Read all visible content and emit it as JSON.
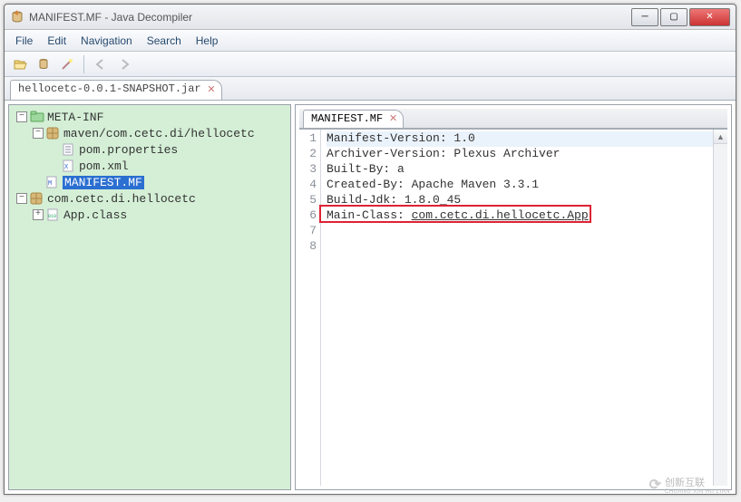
{
  "window": {
    "title": "MANIFEST.MF - Java Decompiler"
  },
  "menu": {
    "file": "File",
    "edit": "Edit",
    "navigation": "Navigation",
    "search": "Search",
    "help": "Help"
  },
  "toolbar_icons": {
    "open": "open-icon",
    "folder": "folder-icon",
    "wand": "wand-icon",
    "back": "back-icon",
    "forward": "forward-icon"
  },
  "file_tab": {
    "label": "hellocetc-0.0.1-SNAPSHOT.jar"
  },
  "tree": {
    "root1": "META-INF",
    "child1": "maven/com.cetc.di/hellocetc",
    "leaf1": "pom.properties",
    "leaf2": "pom.xml",
    "leaf3": "MANIFEST.MF",
    "root2": "com.cetc.di.hellocetc",
    "leaf4": "App.class"
  },
  "editor_tab": {
    "label": "MANIFEST.MF"
  },
  "code": {
    "l1": "Manifest-Version: 1.0",
    "l2": "Archiver-Version: Plexus Archiver",
    "l3": "Built-By: a",
    "l4": "Created-By: Apache Maven 3.3.1",
    "l5": "Build-Jdk: 1.8.0_45",
    "l6_pre": "Main-Class: ",
    "l6_link": "com.cetc.di.hellocetc.App"
  },
  "watermark": {
    "big": "创新互联",
    "small": "CHUANG XIN HU LIAN"
  }
}
